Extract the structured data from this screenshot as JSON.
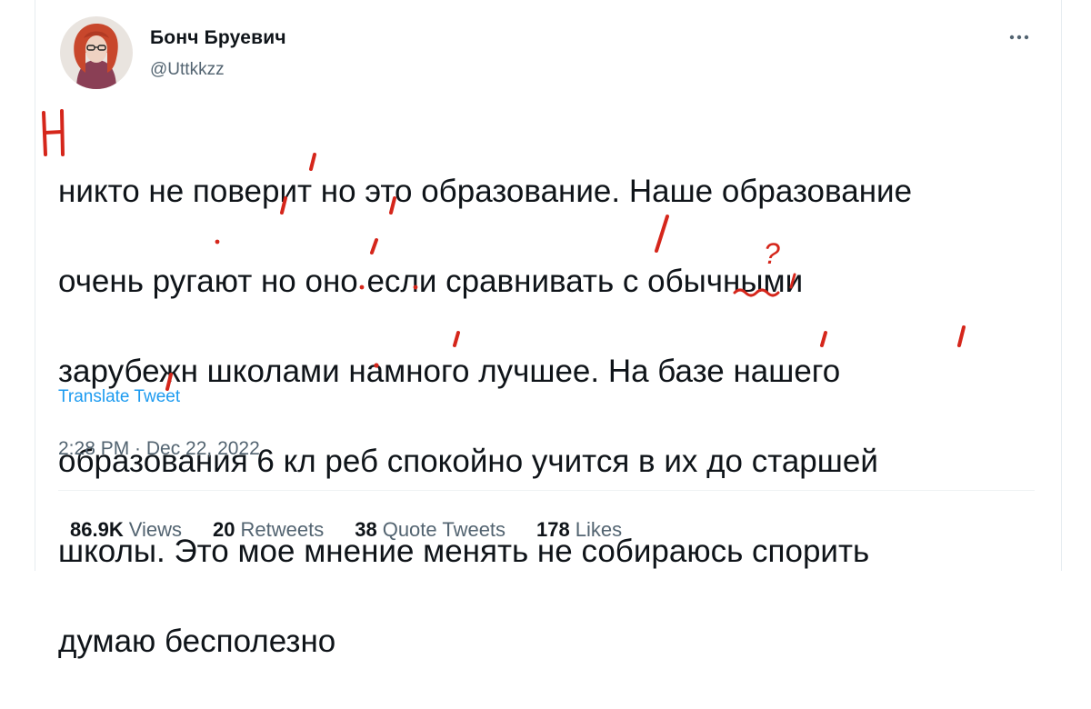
{
  "author": {
    "name": "Бонч Бруевич",
    "handle": "@Uttkkzz"
  },
  "tweet": {
    "lines": [
      "никто не поверит но это образование. Наше образование",
      "очень ругают но оно если сравнивать с обычными",
      "зарубежн школами намного лучшее. На базе нашего",
      "образования 6 кл реб спокойно учится в их до старшей",
      "школы. Это мое мнение менять не собираюсь спорить",
      "думаю бесполезно"
    ],
    "corrections": {
      "capital_letter": "Н",
      "question_mark": "?",
      "strike_letter": "/"
    },
    "translate_label": "Translate Tweet",
    "timestamp": "2:28 PM · Dec 22, 2022"
  },
  "stats": [
    {
      "value": "86.9K",
      "label": "Views"
    },
    {
      "value": "20",
      "label": "Retweets"
    },
    {
      "value": "38",
      "label": "Quote Tweets"
    },
    {
      "value": "178",
      "label": "Likes"
    }
  ],
  "colors": {
    "correction_red": "#d5261b",
    "link_blue": "#1d9bf0",
    "muted": "#536471",
    "text": "#0f1419"
  },
  "icons": {
    "more": "more-horizontal-icon"
  }
}
